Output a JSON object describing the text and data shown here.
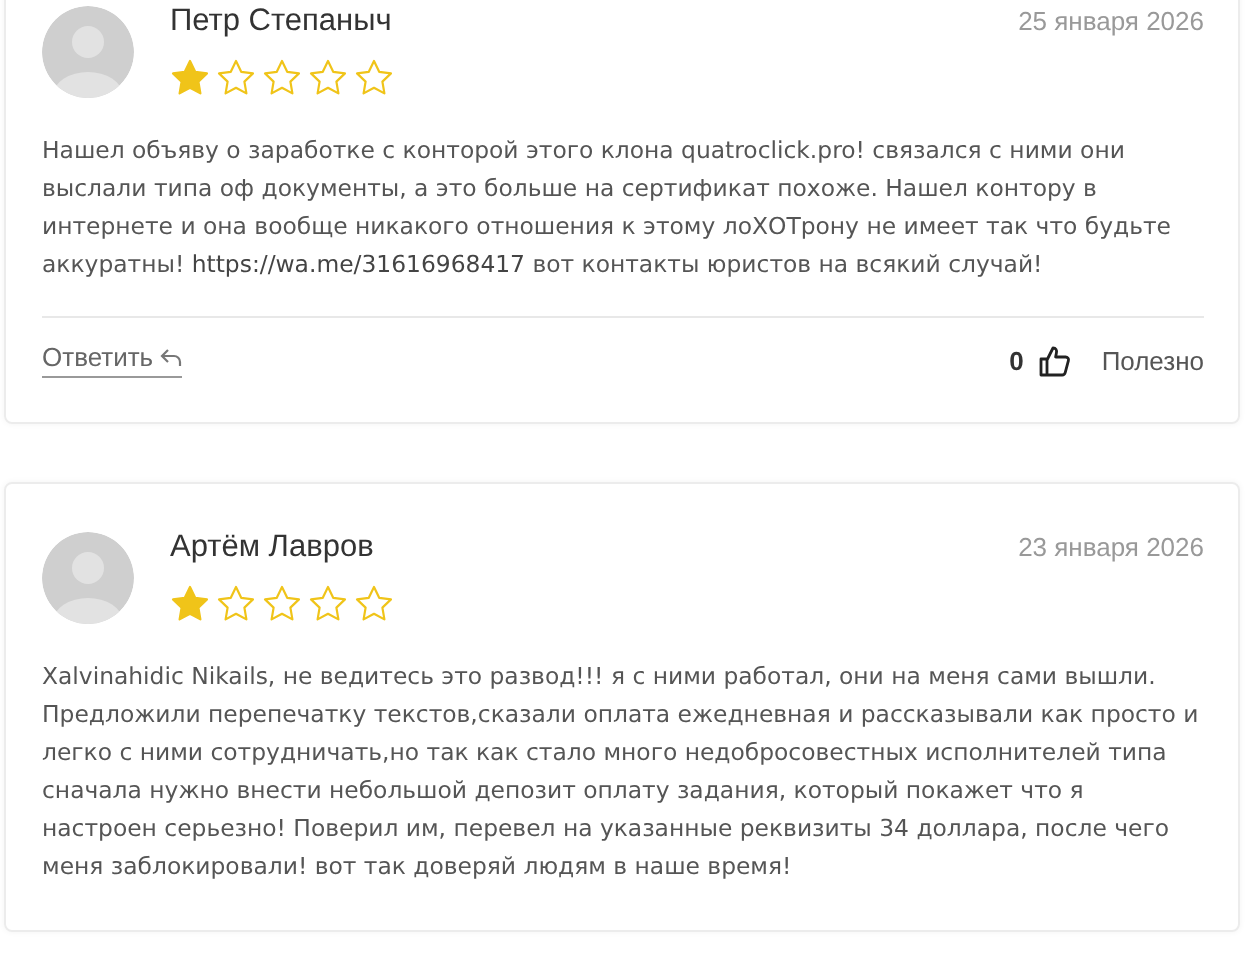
{
  "reviews": [
    {
      "author": "Петр Степаныч",
      "date": "25 января 2026",
      "stars": 1,
      "body": [
        {
          "kind": "text",
          "text": "Нашел объяву о заработке с конторой этого клона quatroclick.pro! связался с ними они выслали типа оф документы, а это больше на сертификат похоже. Нашел контору в интернете и она вообще никакого отношения к этому лоХОТрону не имеет так что будьте аккуратны! "
        },
        {
          "kind": "link",
          "text": "https://wa.me/31616968417"
        },
        {
          "kind": "text",
          "text": " вот контакты юристов на всякий случай!"
        }
      ],
      "footer": {
        "reply": "Ответить",
        "likes": "0",
        "helpful": "Полезно"
      }
    },
    {
      "author": "Артём Лавров",
      "date": "23 января 2026",
      "stars": 1,
      "body": [
        {
          "kind": "text",
          "text": "Xalvinahidic Nikails, не ведитесь это развод!!! я с ними работал, они на меня сами вышли. Предложили перепечатку текстов,сказали оплата ежедневная и рассказывали как просто и легко с ними сотрудничать,но так как стало много недобросовестных исполнителей типа сначала нужно внести небольшой депозит оплату задания, который покажет что я настроен серьезно! Поверил им, перевел на указанные реквизиты 34 доллара, после чего меня заблокировали! вот так доверяй людям в наше время!"
        }
      ]
    }
  ]
}
